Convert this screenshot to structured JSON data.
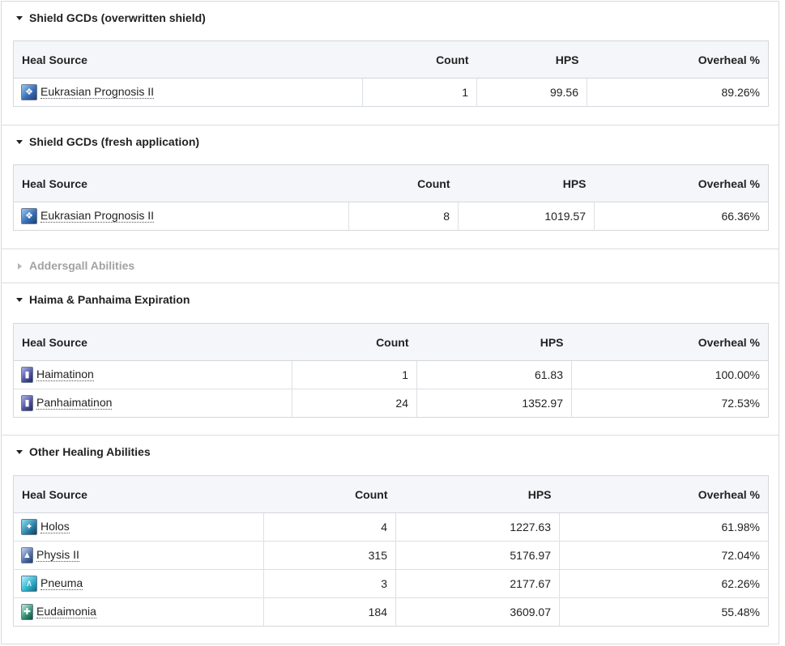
{
  "columns": {
    "source": "Heal Source",
    "count": "Count",
    "hps": "HPS",
    "overheal": "Overheal %"
  },
  "sections": [
    {
      "title": "Shield GCDs (overwritten shield)",
      "expanded": true,
      "rows": [
        {
          "icon": "eukrasian-prognosis-icon",
          "name": "Eukrasian Prognosis II",
          "count": "1",
          "hps": "99.56",
          "overheal": "89.26%"
        }
      ]
    },
    {
      "title": "Shield GCDs (fresh application)",
      "expanded": true,
      "rows": [
        {
          "icon": "eukrasian-prognosis-icon",
          "name": "Eukrasian Prognosis II",
          "count": "8",
          "hps": "1019.57",
          "overheal": "66.36%"
        }
      ]
    },
    {
      "title": "Addersgall Abilities",
      "expanded": false,
      "rows": []
    },
    {
      "title": "Haima & Panhaima Expiration",
      "expanded": true,
      "rows": [
        {
          "icon": "haimatinon-icon",
          "name": "Haimatinon",
          "count": "1",
          "hps": "61.83",
          "overheal": "100.00%"
        },
        {
          "icon": "panhaimatinon-icon",
          "name": "Panhaimatinon",
          "count": "24",
          "hps": "1352.97",
          "overheal": "72.53%"
        }
      ]
    },
    {
      "title": "Other Healing Abilities",
      "expanded": true,
      "rows": [
        {
          "icon": "holos-icon",
          "name": "Holos",
          "count": "4",
          "hps": "1227.63",
          "overheal": "61.98%"
        },
        {
          "icon": "physis-icon",
          "name": "Physis II",
          "count": "315",
          "hps": "5176.97",
          "overheal": "72.04%"
        },
        {
          "icon": "pneuma-icon",
          "name": "Pneuma",
          "count": "3",
          "hps": "2177.67",
          "overheal": "62.26%"
        },
        {
          "icon": "eudaimonia-icon",
          "name": "Eudaimonia",
          "count": "184",
          "hps": "3609.07",
          "overheal": "55.48%"
        }
      ]
    }
  ]
}
